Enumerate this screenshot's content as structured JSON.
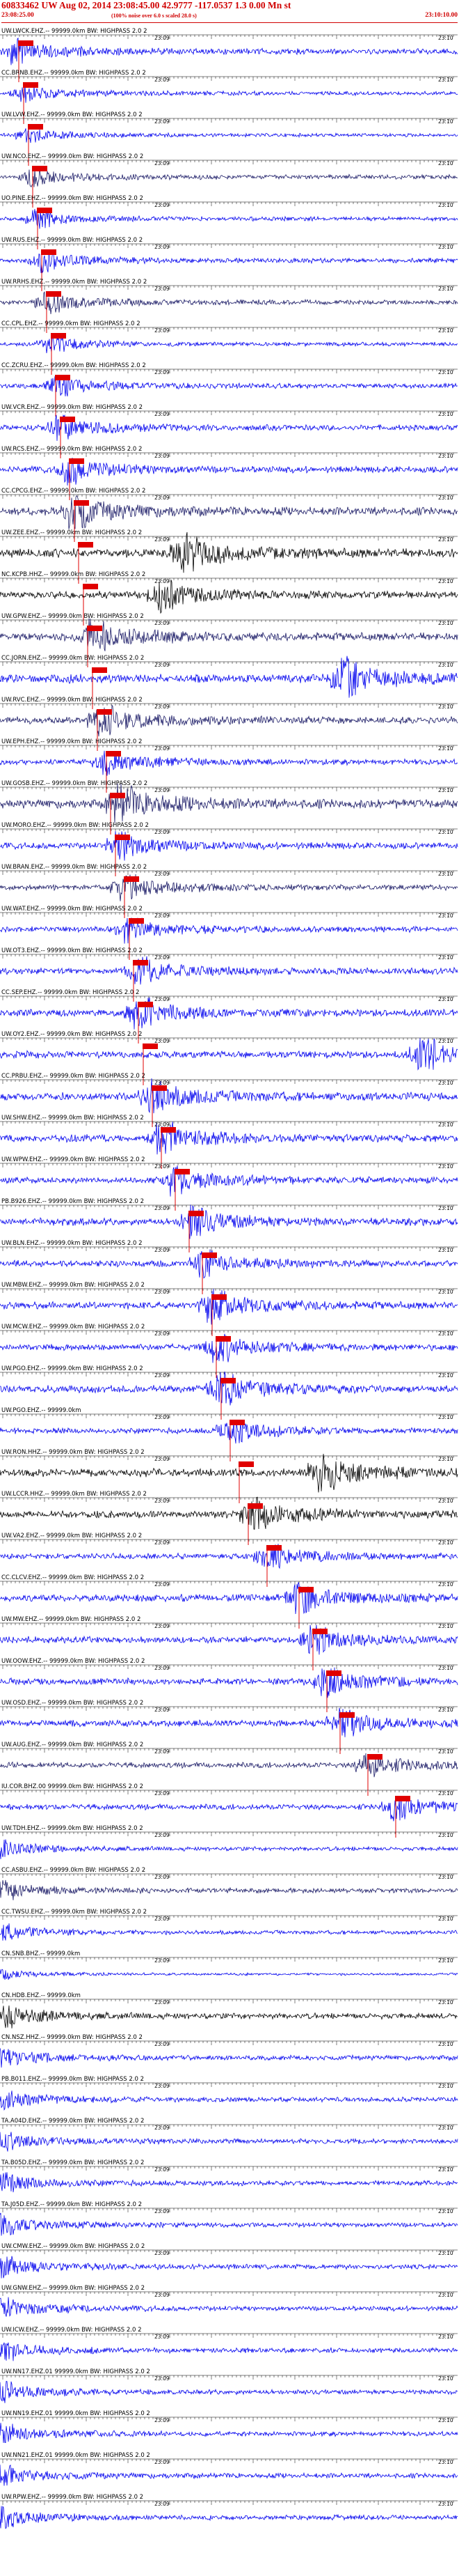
{
  "header": {
    "title": "60833462 UW Aug 02, 2014 23:08:45.00   42.9777  -117.0537  1.3  0.00  Mn  st",
    "start_time": "23:08:25.00",
    "scaling_note": "(100% noise over 6.0 s scaled 28.0 s)",
    "end_time": "23:10:10.00"
  },
  "time_labels": {
    "minute_1": "23:09",
    "minute_2": "23:10"
  },
  "colors": {
    "trace_blue": "#0000ee",
    "trace_dark": "#1a1a66",
    "trace_black": "#000000",
    "pick_red": "#e00000",
    "header_red": "#d00000"
  },
  "channels": [
    {
      "label": "UW.LWCK.EHZ.-- 99999.0km BW: HIGHPASS  2.0  2",
      "color": "blue",
      "amp": 0.35,
      "pick": 0.04,
      "burst": 0.03
    },
    {
      "label": "CC.BRNB.EHZ.-- 99999.0km BW: HIGHPASS  2.0  2",
      "color": "blue",
      "amp": 0.25,
      "pick": 0.05,
      "burst": 0.05
    },
    {
      "label": "UW.LVW.EHZ.-- 99999.0km BW: HIGHPASS  2.0  2",
      "color": "blue",
      "amp": 0.22,
      "pick": 0.06,
      "burst": 0.06
    },
    {
      "label": "UW.NCO.EHZ.-- 99999.0km BW: HIGHPASS  2.0  2",
      "color": "dark",
      "amp": 0.28,
      "pick": 0.07,
      "burst": 0.07
    },
    {
      "label": "UO.PINE.EHZ.-- 99999.0km BW: HIGHPASS  2.0  2",
      "color": "blue",
      "amp": 0.25,
      "pick": 0.08,
      "burst": 0.08
    },
    {
      "label": "UW.RUS.EHZ.-- 99999.0km BW: HIGHPASS  2.0  2",
      "color": "blue",
      "amp": 0.3,
      "pick": 0.09,
      "burst": 0.09
    },
    {
      "label": "UW.RRHS.EHZ.-- 99999.0km BW: HIGHPASS  2.0  2",
      "color": "dark",
      "amp": 0.3,
      "pick": 0.1,
      "burst": 0.1
    },
    {
      "label": "CC.CPL.EHZ.-- 99999.0km BW: HIGHPASS  2.0  2",
      "color": "blue",
      "amp": 0.25,
      "pick": 0.11,
      "burst": 0.11
    },
    {
      "label": "CC.ZCRU.EHZ.-- 99999.0km BW: HIGHPASS  2.0  2",
      "color": "blue",
      "amp": 0.3,
      "pick": 0.12,
      "burst": 0.12
    },
    {
      "label": "UW.VCR.EHZ.-- 99999.0km BW: HIGHPASS  2.0  2",
      "color": "blue",
      "amp": 0.35,
      "pick": 0.13,
      "burst": 0.13
    },
    {
      "label": "UW.RCS.EHZ.-- 99999.0km BW: HIGHPASS  2.0  2",
      "color": "blue",
      "amp": 0.4,
      "pick": 0.15,
      "burst": 0.15
    },
    {
      "label": "CC.CPCG.EHZ.-- 99999.0km BW: HIGHPASS  2.0  2",
      "color": "dark",
      "amp": 0.5,
      "pick": 0.16,
      "burst": 0.16
    },
    {
      "label": "UW.ZEE.EHZ.-- 99999.0km BW: HIGHPASS  2.0  2",
      "color": "black",
      "amp": 0.55,
      "pick": 0.17,
      "burst": 0.4
    },
    {
      "label": "NC.KCPB.HHZ.-- 99999.0km BW: HIGHPASS  2.0  2",
      "color": "black",
      "amp": 0.45,
      "pick": 0.18,
      "burst": 0.35
    },
    {
      "label": "UW.GPW.EHZ.-- 99999.0km BW: HIGHPASS  2.0  2",
      "color": "dark",
      "amp": 0.5,
      "pick": 0.19,
      "burst": 0.2
    },
    {
      "label": "CC.JORN.EHZ.-- 99999.0km BW: HIGHPASS  2.0  2",
      "color": "blue",
      "amp": 0.55,
      "pick": 0.2,
      "burst": 0.75
    },
    {
      "label": "UW.RVC.EHZ.-- 99999.0km BW: HIGHPASS  2.0  2",
      "color": "dark",
      "amp": 0.45,
      "pick": 0.21,
      "burst": 0.22
    },
    {
      "label": "UW.EPH.EHZ.-- 99999.0km BW: HIGHPASS  2.0  2",
      "color": "blue",
      "amp": 0.35,
      "pick": 0.23,
      "burst": 0.23
    },
    {
      "label": "UW.GOSB.EHZ.-- 99999.0km BW: HIGHPASS  2.0  2",
      "color": "dark",
      "amp": 0.55,
      "pick": 0.24,
      "burst": 0.26
    },
    {
      "label": "UW.MORO.EHZ.-- 99999.0km BW: HIGHPASS  2.0  2",
      "color": "blue",
      "amp": 0.4,
      "pick": 0.25,
      "burst": 0.26
    },
    {
      "label": "UW.BRAN.EHZ.-- 99999.0km BW: HIGHPASS  2.0  2",
      "color": "dark",
      "amp": 0.35,
      "pick": 0.27,
      "burst": 0.27
    },
    {
      "label": "UW.WAT.EHZ.-- 99999.0km BW: HIGHPASS  2.0  2",
      "color": "blue",
      "amp": 0.35,
      "pick": 0.28,
      "burst": 0.28
    },
    {
      "label": "UW.OT3.EHZ.-- 99999.0km BW: HIGHPASS  2.0  2",
      "color": "blue",
      "amp": 0.4,
      "pick": 0.29,
      "burst": 0.3
    },
    {
      "label": "CC.SEP.EHZ.-- 99999.0km BW: HIGHPASS  2.0  2",
      "color": "blue",
      "amp": 0.45,
      "pick": 0.3,
      "burst": 0.3
    },
    {
      "label": "UW.OY2.EHZ.-- 99999.0km BW: HIGHPASS  2.0  2",
      "color": "blue",
      "amp": 0.45,
      "pick": 0.31,
      "burst": 0.92
    },
    {
      "label": "CC.PRBU.EHZ.-- 99999.0km BW: HIGHPASS  2.0  2",
      "color": "blue",
      "amp": 0.5,
      "pick": 0.33,
      "burst": 0.33
    },
    {
      "label": "UW.SHW.EHZ.-- 99999.0km BW: HIGHPASS  2.0  2",
      "color": "blue",
      "amp": 0.45,
      "pick": 0.35,
      "burst": 0.35
    },
    {
      "label": "UW.WPW.EHZ.-- 99999.0km BW: HIGHPASS  2.0  2",
      "color": "blue",
      "amp": 0.4,
      "pick": 0.38,
      "burst": 0.38
    },
    {
      "label": "PB.B926.EHZ.-- 99999.0km BW: HIGHPASS  2.0  2",
      "color": "blue",
      "amp": 0.45,
      "pick": 0.41,
      "burst": 0.42
    },
    {
      "label": "UW.BLN.EHZ.-- 99999.0km BW: HIGHPASS  2.0  2",
      "color": "blue",
      "amp": 0.4,
      "pick": 0.44,
      "burst": 0.44
    },
    {
      "label": "UW.MBW.EHZ.-- 99999.0km BW: HIGHPASS  2.0  2",
      "color": "blue",
      "amp": 0.45,
      "pick": 0.46,
      "burst": 0.46
    },
    {
      "label": "UW.MCW.EHZ.-- 99999.0km BW: HIGHPASS  2.0  2",
      "color": "blue",
      "amp": 0.4,
      "pick": 0.47,
      "burst": 0.47
    },
    {
      "label": "UW.PGO.EHZ.-- 99999.0km BW: HIGHPASS  2.0  2",
      "color": "blue",
      "amp": 0.45,
      "pick": 0.48,
      "burst": 0.48
    },
    {
      "label": "UW.PGO.EHZ.-- 99999.0km",
      "color": "blue",
      "amp": 0.35,
      "pick": 0.5,
      "burst": 0.5
    },
    {
      "label": "UW.RON.HHZ.-- 99999.0km BW: HIGHPASS  2.0  2",
      "color": "black",
      "amp": 0.5,
      "pick": 0.52,
      "burst": 0.7
    },
    {
      "label": "UW.LCCR.HHZ.-- 99999.0km BW: HIGHPASS  2.0  2",
      "color": "black",
      "amp": 0.45,
      "pick": 0.54,
      "burst": 0.55
    },
    {
      "label": "UW.VA2.EHZ.-- 99999.0km BW: HIGHPASS  2.0  2",
      "color": "blue",
      "amp": 0.35,
      "pick": 0.58,
      "burst": 0.58
    },
    {
      "label": "CC.CLCV.EHZ.-- 99999.0km BW: HIGHPASS  2.0  2",
      "color": "blue",
      "amp": 0.45,
      "pick": 0.65,
      "burst": 0.65
    },
    {
      "label": "UW.MW.EHZ.-- 99999.0km BW: HIGHPASS  2.0  2",
      "color": "blue",
      "amp": 0.4,
      "pick": 0.68,
      "burst": 0.68
    },
    {
      "label": "UW.OOW.EHZ.-- 99999.0km BW: HIGHPASS  2.0  2",
      "color": "blue",
      "amp": 0.4,
      "pick": 0.71,
      "burst": 0.71
    },
    {
      "label": "UW.OSD.EHZ.-- 99999.0km BW: HIGHPASS  2.0  2",
      "color": "blue",
      "amp": 0.4,
      "pick": 0.74,
      "burst": 0.74
    },
    {
      "label": "UW.AUG.EHZ.-- 99999.0km BW: HIGHPASS  2.0  2",
      "color": "dark",
      "amp": 0.35,
      "pick": 0.8,
      "burst": 0.8
    },
    {
      "label": "IU.COR.BHZ.00 99999.0km BW: HIGHPASS  2.0  2",
      "color": "blue",
      "amp": 0.35,
      "pick": 0.86,
      "burst": 0.86
    },
    {
      "label": "UW.TDH.EHZ.-- 99999.0km BW: HIGHPASS  2.0  2",
      "color": "blue",
      "amp": 0.25,
      "pick": 0.0,
      "burst": 0.0
    },
    {
      "label": "CC.ASBU.EHZ.-- 99999.0km BW: HIGHPASS  2.0  2",
      "color": "dark",
      "amp": 0.3,
      "pick": 0.0,
      "burst": 0.0
    },
    {
      "label": "CC.TWSU.EHZ.-- 99999.0km BW: HIGHPASS  2.0  2",
      "color": "blue",
      "amp": 0.25,
      "pick": 0.0,
      "burst": 0.0
    },
    {
      "label": "CN.SNB.BHZ.-- 99999.0km",
      "color": "blue",
      "amp": 0.15,
      "pick": 0.0,
      "burst": 0.0
    },
    {
      "label": "CN.HDB.EHZ.-- 99999.0km",
      "color": "black",
      "amp": 0.35,
      "pick": 0.0,
      "burst": 0.0
    },
    {
      "label": "CN.NSZ.HHZ.-- 99999.0km BW: HIGHPASS  2.0  2",
      "color": "blue",
      "amp": 0.3,
      "pick": 0.0,
      "burst": 0.0
    },
    {
      "label": "PB.B011.EHZ.-- 99999.0km BW: HIGHPASS  2.0  2",
      "color": "blue",
      "amp": 0.3,
      "pick": 0.0,
      "burst": 0.0
    },
    {
      "label": "TA.A04D.EHZ.-- 99999.0km BW: HIGHPASS  2.0  2",
      "color": "blue",
      "amp": 0.3,
      "pick": 0.0,
      "burst": 0.0
    },
    {
      "label": "TA.B05D.EHZ.-- 99999.0km BW: HIGHPASS  2.0  2",
      "color": "blue",
      "amp": 0.3,
      "pick": 0.0,
      "burst": 0.0
    },
    {
      "label": "TA.J05D.EHZ.-- 99999.0km BW: HIGHPASS  2.0  2",
      "color": "blue",
      "amp": 0.3,
      "pick": 0.0,
      "burst": 0.0
    },
    {
      "label": "UW.CMW.EHZ.-- 99999.0km BW: HIGHPASS  2.0  2",
      "color": "blue",
      "amp": 0.3,
      "pick": 0.0,
      "burst": 0.0
    },
    {
      "label": "UW.GNW.EHZ.-- 99999.0km BW: HIGHPASS  2.0  2",
      "color": "blue",
      "amp": 0.3,
      "pick": 0.0,
      "burst": 0.0
    },
    {
      "label": "UW.ICW.EHZ.-- 99999.0km BW: HIGHPASS  2.0  2",
      "color": "blue",
      "amp": 0.3,
      "pick": 0.0,
      "burst": 0.0
    },
    {
      "label": "UW.NN17.EHZ.01 99999.0km BW: HIGHPASS  2.0  2",
      "color": "blue",
      "amp": 0.3,
      "pick": 0.0,
      "burst": 0.0
    },
    {
      "label": "UW.NN19.EHZ.01 99999.0km BW: HIGHPASS  2.0  2",
      "color": "blue",
      "amp": 0.3,
      "pick": 0.0,
      "burst": 0.0
    },
    {
      "label": "UW.NN21.EHZ.01 99999.0km BW: HIGHPASS  2.0  2",
      "color": "blue",
      "amp": 0.3,
      "pick": 0.0,
      "burst": 0.0
    },
    {
      "label": "UW.RPW.EHZ.-- 99999.0km BW: HIGHPASS  2.0  2",
      "color": "blue",
      "amp": 0.3,
      "pick": 0.0,
      "burst": 0.0
    }
  ]
}
